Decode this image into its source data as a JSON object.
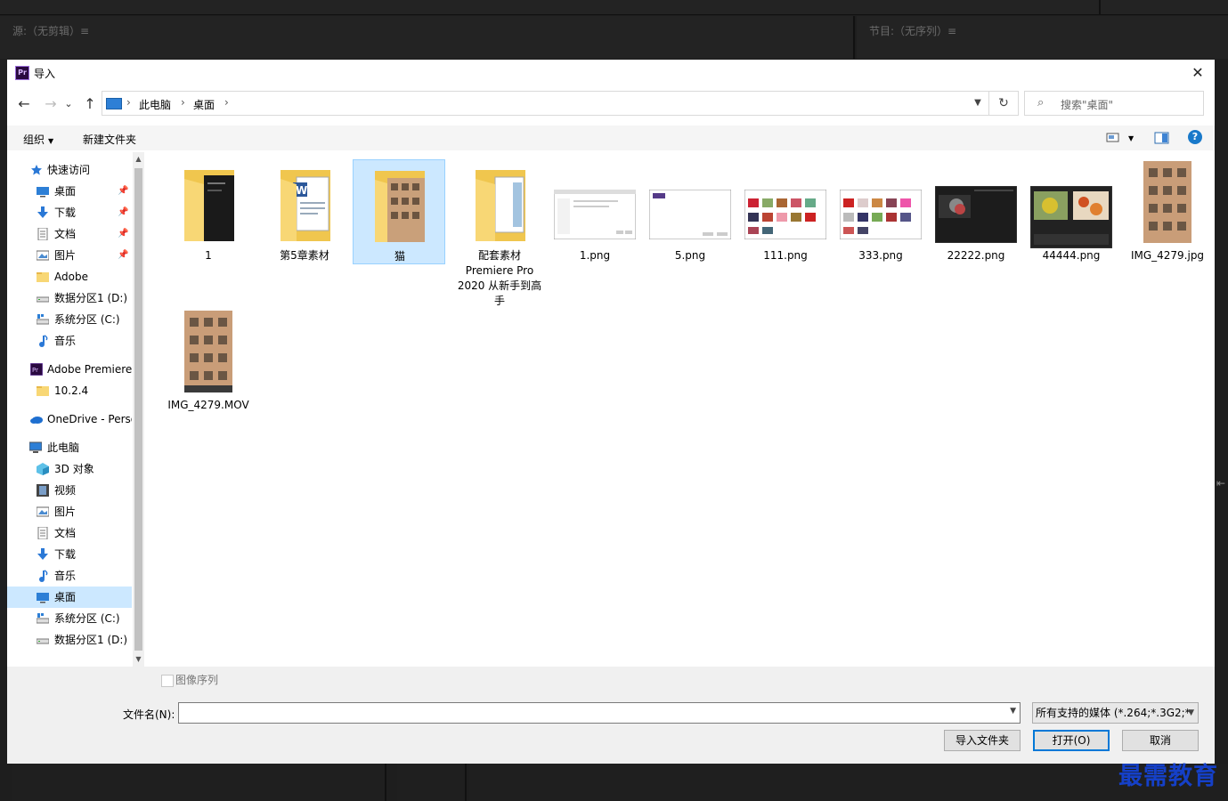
{
  "background": {
    "source_panel_title": "源:（无剪辑）≡",
    "program_panel_title": "节目:（无序列）≡"
  },
  "dialog": {
    "title": "导入",
    "app_icon_text": "Pr",
    "close_glyph": "✕"
  },
  "nav": {
    "back": "←",
    "forward": "→",
    "recent": "⌄",
    "up": "↑",
    "breadcrumb": [
      "此电脑",
      "桌面"
    ],
    "crumb_sep": "›",
    "refresh": "↻",
    "search_placeholder": "搜索\"桌面\""
  },
  "toolbar": {
    "organize": "组织",
    "new_folder": "新建文件夹"
  },
  "sidebar": {
    "items": [
      {
        "label": "快速访问",
        "icon": "star-icon",
        "pinned": false
      },
      {
        "label": "桌面",
        "icon": "desktop-icon",
        "pinned": true
      },
      {
        "label": "下载",
        "icon": "download-icon",
        "pinned": true
      },
      {
        "label": "文档",
        "icon": "document-icon",
        "pinned": true
      },
      {
        "label": "图片",
        "icon": "pictures-icon",
        "pinned": true
      },
      {
        "label": "Adobe",
        "icon": "folder-icon",
        "pinned": false
      },
      {
        "label": "数据分区1 (D:)",
        "icon": "drive-icon",
        "pinned": false
      },
      {
        "label": "系统分区 (C:)",
        "icon": "system-drive-icon",
        "pinned": false
      },
      {
        "label": "音乐",
        "icon": "music-icon",
        "pinned": false
      },
      {
        "label": "Adobe Premiere",
        "icon": "premiere-icon",
        "pinned": false
      },
      {
        "label": "10.2.4",
        "icon": "folder-icon",
        "pinned": false
      },
      {
        "label": "OneDrive - Perso",
        "icon": "onedrive-icon",
        "pinned": false
      },
      {
        "label": "此电脑",
        "icon": "computer-icon",
        "pinned": false
      },
      {
        "label": "3D 对象",
        "icon": "3d-objects-icon",
        "pinned": false
      },
      {
        "label": "视频",
        "icon": "video-icon",
        "pinned": false
      },
      {
        "label": "图片",
        "icon": "pictures-icon",
        "pinned": false
      },
      {
        "label": "文档",
        "icon": "document-icon",
        "pinned": false
      },
      {
        "label": "下载",
        "icon": "download-icon",
        "pinned": false
      },
      {
        "label": "音乐",
        "icon": "music-icon",
        "pinned": false
      },
      {
        "label": "桌面",
        "icon": "desktop-icon",
        "pinned": false,
        "selected": true
      },
      {
        "label": "系统分区 (C:)",
        "icon": "system-drive-icon",
        "pinned": false
      },
      {
        "label": "数据分区1 (D:)",
        "icon": "drive-icon",
        "pinned": false
      }
    ]
  },
  "files": [
    {
      "name": "1",
      "type": "folder",
      "icon": "folder-dark-doc-icon"
    },
    {
      "name": "第5章素材",
      "type": "folder",
      "icon": "folder-word-icon"
    },
    {
      "name": "猫",
      "type": "folder",
      "icon": "folder-photo-icon",
      "selected": true
    },
    {
      "name": "配套素材 Premiere Pro 2020 从新手到高手",
      "type": "folder",
      "icon": "folder-doc-icon"
    },
    {
      "name": "1.png",
      "type": "image",
      "icon": "screenshot-white-icon"
    },
    {
      "name": "5.png",
      "type": "image",
      "icon": "screenshot-white-icon"
    },
    {
      "name": "111.png",
      "type": "image",
      "icon": "screenshot-gallery-icon"
    },
    {
      "name": "333.png",
      "type": "image",
      "icon": "screenshot-gallery-icon"
    },
    {
      "name": "22222.png",
      "type": "image",
      "icon": "screenshot-dark-icon"
    },
    {
      "name": "44444.png",
      "type": "image",
      "icon": "screenshot-food-icon"
    },
    {
      "name": "IMG_4279.jpg",
      "type": "image",
      "icon": "building-photo-icon"
    },
    {
      "name": "IMG_4279.MOV",
      "type": "video",
      "icon": "building-video-icon"
    }
  ],
  "bottom": {
    "image_sequence_label": "图像序列",
    "filename_label": "文件名(N):",
    "filename_value": "",
    "filetype_value": "所有支持的媒体 (*.264;*.3G2;*",
    "import_folder_btn": "导入文件夹",
    "open_btn": "打开(O)",
    "cancel_btn": "取消"
  },
  "watermark": "最需教育"
}
